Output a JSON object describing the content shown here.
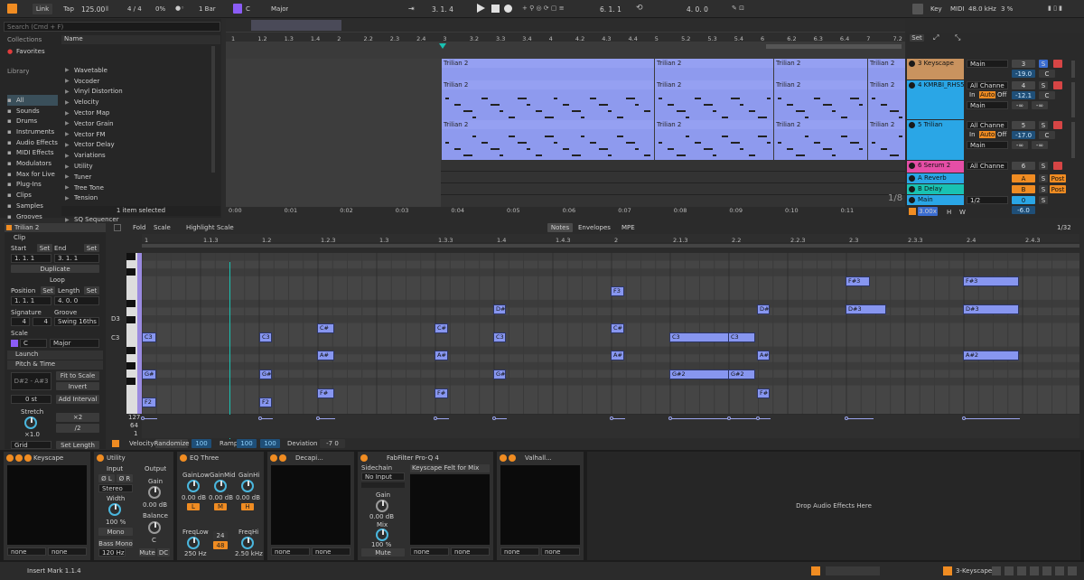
{
  "transport": {
    "link": "Link",
    "tap": "Tap",
    "tempo": "125.00",
    "signature": "4 / 4",
    "swing": "0%",
    "quantize": "1 Bar",
    "key": "C",
    "scale": "Major",
    "position": "3.   1.   4",
    "loop_start": "6.   1.   1",
    "loop_length": "4.   0.   0",
    "key_label": "Key",
    "midi_label": "MIDI",
    "sample_rate": "48.0 kHz",
    "cpu": "3 %"
  },
  "browser": {
    "search_placeholder": "Search (Cmd + F)",
    "collections_label": "Collections",
    "favorites": "Favorites",
    "library_label": "Library",
    "categories": [
      "All",
      "Sounds",
      "Drums",
      "Instruments",
      "Audio Effects",
      "MIDI Effects",
      "Modulators",
      "Max for Live",
      "Plug-Ins",
      "Clips",
      "Samples",
      "Grooves",
      "Tunings"
    ],
    "name_header": "Name",
    "items": [
      "Wavetable",
      "Vocoder",
      "Vinyl Distortion",
      "Velocity",
      "Vector Map",
      "Vector Grain",
      "Vector FM",
      "Vector Delay",
      "Variations",
      "Utility",
      "Tuner",
      "Tree Tone",
      "Tension",
      "Step Arp",
      "SQ Sequencer"
    ],
    "status": "1 item selected"
  },
  "arrangement": {
    "bar_labels": [
      "1",
      "1.2",
      "1.3",
      "1.4",
      "2",
      "2.2",
      "2.3",
      "2.4",
      "3",
      "3.2",
      "3.3",
      "3.4",
      "4",
      "4.2",
      "4.3",
      "4.4",
      "5",
      "5.2",
      "5.3",
      "5.4",
      "6",
      "6.2",
      "6.3",
      "6.4",
      "7",
      "7.2"
    ],
    "time_labels": [
      "0:00",
      "0:01",
      "0:02",
      "0:03",
      "0:04",
      "0:05",
      "0:06",
      "0:07",
      "0:08",
      "0:09",
      "0:10",
      "0:11"
    ],
    "clip_name": "Trilian 2",
    "grid": "1/8",
    "set_label": "Set",
    "zoom": "3.00x",
    "h_label": "H",
    "w_label": "W"
  },
  "tracks": [
    {
      "name": "3 Keyscape",
      "color": "#c9935f",
      "routing": "Main",
      "num": "3",
      "vol": "-19.0",
      "pan": "C"
    },
    {
      "name": "4 KMRBI_RHS5",
      "color": "#2aa6e6",
      "routing": "All Channe",
      "num": "4",
      "vol": "-12.1",
      "pan": "C",
      "in": "In",
      "auto": "Auto",
      "off": "Off",
      "sub": "Main",
      "send1": "-∞",
      "send2": "-∞"
    },
    {
      "name": "5 Trilian",
      "color": "#2aa6e6",
      "routing": "All Channe",
      "num": "5",
      "vol": "-17.0",
      "pan": "C",
      "in": "In",
      "auto": "Auto",
      "off": "Off",
      "sub": "Main",
      "send1": "-∞",
      "send2": "-∞"
    },
    {
      "name": "6 Serum 2",
      "color": "#e54ea6",
      "routing": "All Channe",
      "num": "6"
    },
    {
      "name": "A Reverb",
      "color": "#2aa6e6",
      "num": "A",
      "post": "Post"
    },
    {
      "name": "B Delay",
      "color": "#19c2b2",
      "num": "B",
      "post": "Post"
    },
    {
      "name": "Main",
      "color": "#2aa6e6",
      "routing": "1/2",
      "num": "0",
      "vol": "-6.0"
    }
  ],
  "clip_view": {
    "title": "Trilian 2",
    "clip_label": "Clip",
    "start_label": "Start",
    "end_label": "End",
    "set": "Set",
    "start_val": "1.   1.   1",
    "end_val": "3.   1.   1",
    "duplicate": "Duplicate",
    "loop": "Loop",
    "position_label": "Position",
    "length_label": "Length",
    "position_val": "1.   1.   1",
    "length_val": "4.   0.   0",
    "signature_label": "Signature",
    "groove_label": "Groove",
    "sig_num": "4",
    "sig_den": "4",
    "groove_val": "Swing 16ths",
    "scale_label": "Scale",
    "scale_key": "C",
    "scale_mode": "Major",
    "launch_label": "Launch",
    "pitch_label": "Pitch & Time",
    "range": "D#2 - A#3",
    "fit_to_scale": "Fit to Scale",
    "invert": "Invert",
    "interval": "0 st",
    "add_interval": "Add Interval",
    "stretch_label": "Stretch",
    "stretch_val": "×1.0",
    "x2": "×2",
    "half": "/2",
    "grid_label": "Grid",
    "set_length": "Set Length"
  },
  "note_editor": {
    "fold": "Fold",
    "scale": "Scale",
    "highlight_scale": "Highlight Scale",
    "tabs": [
      "Notes",
      "Envelopes",
      "MPE"
    ],
    "grid": "1/32",
    "ruler": [
      "1",
      "1.1.3",
      "1.2",
      "1.2.3",
      "1.3",
      "1.3.3",
      "1.4",
      "1.4.3",
      "2",
      "2.1.3",
      "2.2",
      "2.2.3",
      "2.3",
      "2.3.3",
      "2.4",
      "2.4.3"
    ],
    "key_labels": [
      "D3",
      "C3"
    ],
    "notes": [
      {
        "label": "F#3",
        "col": 0
      },
      {
        "label": "F3",
        "col": 0
      },
      {
        "label": "D#3",
        "col": 0
      },
      {
        "label": "C#3",
        "col": 0
      },
      {
        "label": "C3",
        "col": 0
      },
      {
        "label": "A#2",
        "col": 0
      },
      {
        "label": "G#2",
        "col": 0
      },
      {
        "label": "F#2",
        "col": 0
      },
      {
        "label": "F2",
        "col": 0
      },
      {
        "label": "G#",
        "col": 0
      },
      {
        "label": "C#",
        "col": 0
      },
      {
        "label": "A#",
        "col": 0
      },
      {
        "label": "F#",
        "col": 0
      },
      {
        "label": "C3",
        "col": 0
      },
      {
        "label": "D#",
        "col": 0
      },
      {
        "label": "F3",
        "col": 0
      },
      {
        "label": "F#3",
        "col": 0
      }
    ],
    "vel_max": "127",
    "vel_mid": "64",
    "vel_min": "1",
    "velocity_label": "Velocity",
    "randomize": "Randomize",
    "randomize_val": "100",
    "ramp": "Ramp",
    "ramp_val1": "100",
    "ramp_val2": "100",
    "deviation": "Deviation",
    "deviation_val": "-7   0"
  },
  "devices": {
    "keyscape": {
      "name": "Keyscape",
      "in1": "none",
      "in2": "none"
    },
    "utility": {
      "name": "Utility",
      "input": "Input",
      "output": "Output",
      "phase_l": "Ø L",
      "phase_r": "Ø R",
      "mode": "Stereo",
      "gain_label": "Gain",
      "gain_val": "0.00 dB",
      "width_label": "Width",
      "width_val": "100 %",
      "mono": "Mono",
      "balance_label": "Balance",
      "balance_val": "C",
      "bass_mono": "Bass Mono",
      "bass_freq": "120 Hz",
      "mute": "Mute",
      "dc": "DC"
    },
    "eq": {
      "name": "EQ Three",
      "low": "GainLow",
      "mid": "GainMid",
      "hi": "GainHi",
      "low_val": "0.00 dB",
      "mid_val": "0.00 dB",
      "hi_val": "0.00 dB",
      "l": "L",
      "m": "M",
      "h": "H",
      "freqlow": "FreqLow",
      "freqhi": "FreqHi",
      "freqlow_val": "250 Hz",
      "freqhi_val": "2.50 kHz",
      "slope1": "24",
      "slope2": "48"
    },
    "decapitator": {
      "name": "Decapi...",
      "in1": "none",
      "in2": "none"
    },
    "fabfilter": {
      "name": "FabFilter Pro-Q 4",
      "sidechain": "Sidechain",
      "input": "No Input",
      "gain_label": "Gain",
      "gain_val": "0.00 dB",
      "mix_label": "Mix",
      "mix_val": "100 %",
      "mute": "Mute",
      "preset": "Keyscape Felt for Mix",
      "in1": "none",
      "in2": "none"
    },
    "valhalla": {
      "name": "Valhall...",
      "in1": "none",
      "in2": "none"
    },
    "drop": "Drop Audio Effects Here"
  },
  "status_bar": {
    "text": "Insert Mark 1.1.4",
    "track": "3-Keyscape"
  },
  "colors": {
    "accent": "#f08c22",
    "clip": "#8e9aee",
    "note": "#8796f0",
    "track_blue": "#2aa6e6"
  }
}
